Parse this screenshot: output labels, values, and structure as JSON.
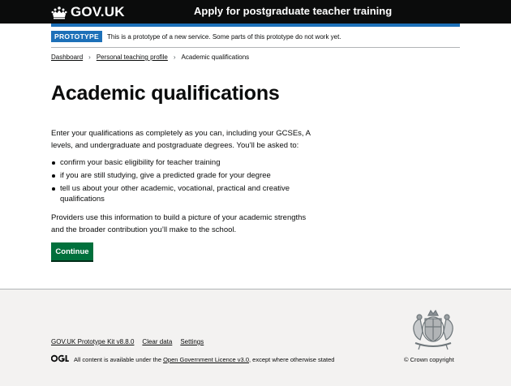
{
  "header": {
    "logo_text": "GOV.UK",
    "service_name": "Apply for postgraduate teacher training"
  },
  "phase_banner": {
    "tag": "PROTOTYPE",
    "text": "This is a prototype of a new service. Some parts of this prototype do not work yet."
  },
  "breadcrumbs": {
    "items": [
      {
        "label": "Dashboard"
      },
      {
        "label": "Personal teaching profile"
      },
      {
        "label": "Academic qualifications"
      }
    ]
  },
  "main": {
    "heading": "Academic qualifications",
    "intro": "Enter your qualifications as completely as you can, including your GCSEs, A levels, and undergraduate and postgraduate degrees. You’ll be asked to:",
    "bullets": [
      "confirm your basic eligibility for teacher training",
      "if you are still studying, give a predicted grade for your degree",
      "tell us about your other academic, vocational, practical and creative qualifications"
    ],
    "providers_text": "Providers use this information to build a picture of your academic strengths and the broader contribution you’ll make to the school.",
    "continue_label": "Continue"
  },
  "footer": {
    "links": [
      {
        "label": "GOV.UK Prototype Kit v8.8.0"
      },
      {
        "label": "Clear data"
      },
      {
        "label": "Settings"
      }
    ],
    "licence_prefix": "All content is available under the",
    "licence_link": "Open Government Licence v3.0",
    "licence_suffix": ", except where otherwise stated",
    "copyright": "© Crown copyright"
  },
  "icons": {
    "logo": "crown-icon",
    "breadcrumb_separator": "chevron-right-icon",
    "ogl": "ogl-logo-icon",
    "crest": "royal-coat-of-arms-icon"
  },
  "colors": {
    "header_bg": "#0b0c0c",
    "brand_blue": "#1d70b8",
    "button_green": "#00703c",
    "footer_bg": "#f3f2f1"
  }
}
